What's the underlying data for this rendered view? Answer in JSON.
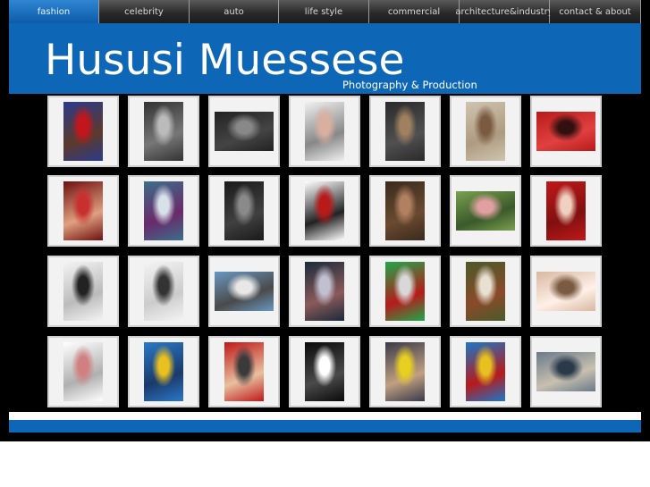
{
  "nav": {
    "items": [
      {
        "label": "fashion",
        "active": true
      },
      {
        "label": "celebrity"
      },
      {
        "label": "auto"
      },
      {
        "label": "life style"
      },
      {
        "label": "commercial"
      },
      {
        "label": "architecture&industry"
      },
      {
        "label": "contact & about"
      }
    ]
  },
  "header": {
    "brand": "Hususi Muessese",
    "tagline": "Photography & Production"
  },
  "gallery": {
    "rows": [
      [
        {
          "subject": "couple",
          "orient": "portrait",
          "colors": [
            "#2a3b8c",
            "#c2161c",
            "#5d3a2a"
          ]
        },
        {
          "subject": "men-on-stairs",
          "orient": "portrait",
          "colors": [
            "#333333",
            "#bbbbbb",
            "#777777"
          ]
        },
        {
          "subject": "group",
          "orient": "landscape",
          "colors": [
            "#222222",
            "#888888",
            "#444444"
          ]
        },
        {
          "subject": "woman-white",
          "orient": "portrait",
          "colors": [
            "#f0f0f0",
            "#d9b0a0",
            "#888888"
          ]
        },
        {
          "subject": "woman-door",
          "orient": "portrait",
          "colors": [
            "#2a2a2a",
            "#a08060",
            "#505050"
          ]
        },
        {
          "subject": "woman-bags",
          "orient": "portrait",
          "colors": [
            "#cfc4b0",
            "#7a5a40",
            "#ae9b80"
          ]
        },
        {
          "subject": "woman-red-car",
          "orient": "landscape",
          "colors": [
            "#b81a1a",
            "#331010",
            "#e04040"
          ]
        }
      ],
      [
        {
          "subject": "red-dress",
          "orient": "portrait",
          "colors": [
            "#6e1010",
            "#c83030",
            "#e0a080"
          ]
        },
        {
          "subject": "smoke",
          "orient": "portrait",
          "colors": [
            "#3b6e8a",
            "#d8e0e8",
            "#6a2a6a"
          ]
        },
        {
          "subject": "lying-woman",
          "orient": "portrait",
          "colors": [
            "#1a1a1a",
            "#8a8a8a",
            "#404040"
          ]
        },
        {
          "subject": "red-gown",
          "orient": "portrait",
          "colors": [
            "#ffffff",
            "#b81a1a",
            "#222222"
          ]
        },
        {
          "subject": "woman-floor",
          "orient": "portrait",
          "colors": [
            "#3a2a1e",
            "#b08060",
            "#6a4a30"
          ]
        },
        {
          "subject": "bikini-grass",
          "orient": "landscape",
          "colors": [
            "#7aa050",
            "#e0a0a0",
            "#3a5a2a"
          ]
        },
        {
          "subject": "red-wall",
          "orient": "portrait",
          "colors": [
            "#c01818",
            "#f0d0c0",
            "#801010"
          ]
        }
      ],
      [
        {
          "subject": "legs-bw",
          "orient": "portrait",
          "colors": [
            "#f4f4f4",
            "#222222",
            "#bbbbbb"
          ]
        },
        {
          "subject": "feet-bw",
          "orient": "portrait",
          "colors": [
            "#f4f4f4",
            "#333333",
            "#cccccc"
          ]
        },
        {
          "subject": "man-rail",
          "orient": "landscape",
          "colors": [
            "#6a98c0",
            "#e8e8e8",
            "#4a4a4a"
          ]
        },
        {
          "subject": "woman-dark",
          "orient": "portrait",
          "colors": [
            "#1a2a3a",
            "#c0c0d0",
            "#8a5a5a"
          ]
        },
        {
          "subject": "green-screen",
          "orient": "portrait",
          "colors": [
            "#1ea84a",
            "#d8d8d8",
            "#b81a1a"
          ]
        },
        {
          "subject": "group-outdoor",
          "orient": "portrait",
          "colors": [
            "#4a5a2a",
            "#e8e0d0",
            "#8a4a2a"
          ]
        },
        {
          "subject": "stocking-leg",
          "orient": "landscape",
          "colors": [
            "#d8b8a0",
            "#7a5a40",
            "#fff0e8"
          ]
        }
      ],
      [
        {
          "subject": "dancer",
          "orient": "portrait",
          "colors": [
            "#ffffff",
            "#d08080",
            "#b0b0b0"
          ]
        },
        {
          "subject": "couple-yellow",
          "orient": "portrait",
          "colors": [
            "#2a78c8",
            "#e8c020",
            "#1a3a6a"
          ]
        },
        {
          "subject": "red-machine",
          "orient": "portrait",
          "colors": [
            "#c01818",
            "#3a3a3a",
            "#e8c0a0"
          ]
        },
        {
          "subject": "man-white-suit",
          "orient": "portrait",
          "colors": [
            "#0a0a0a",
            "#ffffff",
            "#4a4a4a"
          ]
        },
        {
          "subject": "yellow-shorts",
          "orient": "portrait",
          "colors": [
            "#3a3a4a",
            "#e8d020",
            "#c0a080"
          ]
        },
        {
          "subject": "boat",
          "orient": "portrait",
          "colors": [
            "#1a78c8",
            "#e8c020",
            "#b81a1a"
          ]
        },
        {
          "subject": "beach-chair",
          "orient": "landscape",
          "colors": [
            "#6a7a8a",
            "#2a3a4a",
            "#c8c0b0"
          ]
        }
      ]
    ]
  }
}
